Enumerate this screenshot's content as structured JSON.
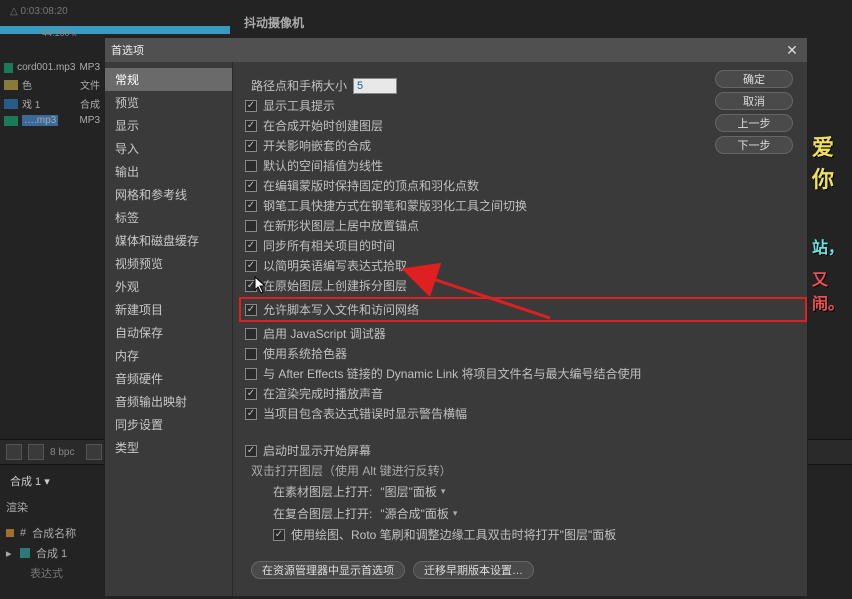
{
  "bg": {
    "timecode": "△ 0:03:08:20",
    "samplerate": "44.100 k",
    "top_label": "抖动摄像机",
    "files": [
      {
        "name": "cord001.mp3",
        "type_label": "MP3",
        "iconcls": "mp3"
      },
      {
        "name": "色",
        "type_label": "文件",
        "iconcls": "folder"
      },
      {
        "name": "戏 1",
        "type_label": "合成",
        "iconcls": ""
      },
      {
        "name": "….mp3",
        "type_label": "MP3",
        "iconcls": "mp3",
        "selected": true
      }
    ],
    "right1": "爱你",
    "right2": "站，",
    "right3": "又闹。",
    "bpc": "8 bpc",
    "tab": "合成 1 ▾",
    "render": "渲染",
    "tbl_col": "合成名称",
    "tbl_row1": "合成 1",
    "tbl_row2": "表达式"
  },
  "dialog": {
    "title": "首选项",
    "close": "✕",
    "nav": [
      "常规",
      "预览",
      "显示",
      "导入",
      "输出",
      "网格和参考线",
      "标签",
      "媒体和磁盘缓存",
      "视频预览",
      "外观",
      "新建项目",
      "自动保存",
      "内存",
      "音频硬件",
      "音频输出映射",
      "同步设置",
      "类型"
    ],
    "nav_selected_index": 0,
    "buttons": {
      "ok": "确定",
      "cancel": "取消",
      "prev": "上一步",
      "next": "下一步"
    },
    "path_label": "路径点和手柄大小",
    "path_value": "5",
    "checks": [
      {
        "label": "显示工具提示",
        "checked": true
      },
      {
        "label": "在合成开始时创建图层",
        "checked": true
      },
      {
        "label": "开关影响嵌套的合成",
        "checked": true
      },
      {
        "label": "默认的空间插值为线性",
        "checked": false
      },
      {
        "label": "在编辑蒙版时保持固定的顶点和羽化点数",
        "checked": true
      },
      {
        "label": "钢笔工具快捷方式在钢笔和蒙版羽化工具之间切换",
        "checked": true
      },
      {
        "label": "在新形状图层上居中放置锚点",
        "checked": false
      },
      {
        "label": "同步所有相关项目的时间",
        "checked": true
      },
      {
        "label": "以简明英语编写表达式拾取",
        "checked": true
      },
      {
        "label": "在原始图层上创建拆分图层",
        "checked": true
      },
      {
        "label": "允许脚本写入文件和访问网络",
        "checked": true,
        "highlight": true
      },
      {
        "label": "启用 JavaScript 调试器",
        "checked": false
      },
      {
        "label": "使用系统拾色器",
        "checked": false
      },
      {
        "label": "与 After Effects 链接的 Dynamic Link 将项目文件名与最大编号结合使用",
        "checked": false
      },
      {
        "label": "在渲染完成时播放声音",
        "checked": true
      },
      {
        "label": "当项目包含表达式错误时显示警告横幅",
        "checked": true
      }
    ],
    "splash": {
      "label": "启动时显示开始屏幕",
      "checked": true
    },
    "dbl_label": "双击打开图层（使用 Alt 键进行反转）",
    "dbl_row1_label": "在素材图层上打开:",
    "dbl_row1_value": "\"图层\"面板",
    "dbl_row2_label": "在复合图层上打开:",
    "dbl_row2_value": "\"源合成\"面板",
    "dbl_cb": {
      "label": "使用绘图、Roto 笔刷和调整边缘工具双击时将打开\"图层\"面板",
      "checked": true
    },
    "pill1": "在资源管理器中显示首选项",
    "pill2": "迁移早期版本设置…"
  }
}
